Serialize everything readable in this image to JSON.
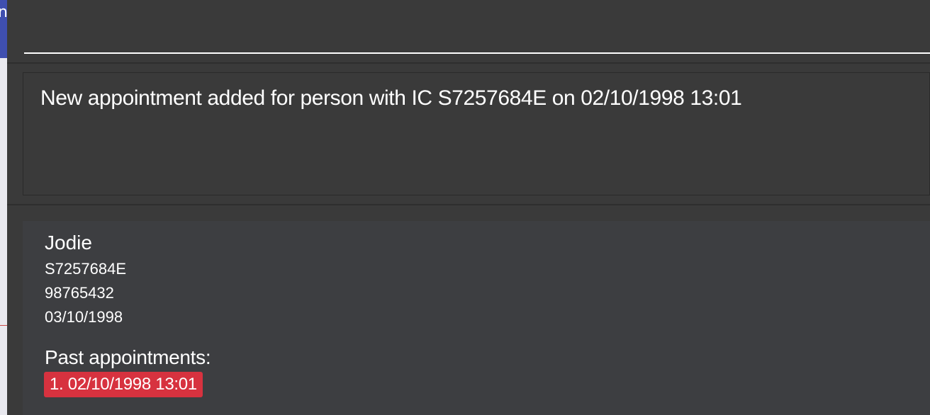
{
  "left_edge": {
    "glyph": "n"
  },
  "command": {
    "value": "",
    "placeholder": ""
  },
  "result": {
    "message": "New appointment added for person with IC S7257684E on 02/10/1998 13:01"
  },
  "person": {
    "name": "Jodie",
    "ic": "S7257684E",
    "phone": "98765432",
    "date": "03/10/1998",
    "past_appointments_label": "Past appointments:",
    "past_appointments": [
      "1. 02/10/1998 13:01"
    ]
  },
  "colors": {
    "background": "#3a3a3a",
    "card": "#3d3e41",
    "accent_blue": "#3f4fb0",
    "appointment_tag": "#d7323f",
    "text": "#ffffff"
  }
}
